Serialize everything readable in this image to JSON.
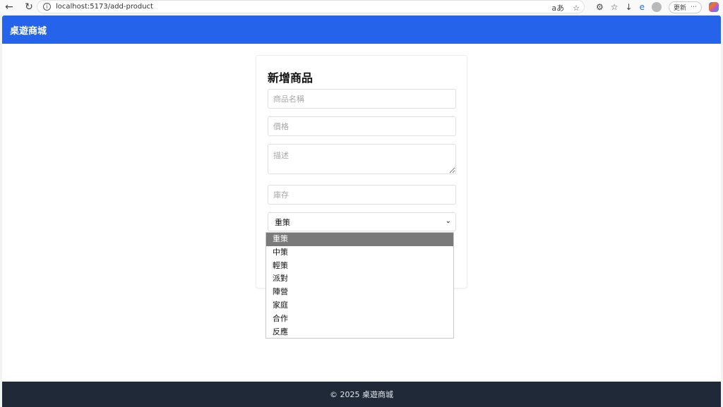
{
  "browser": {
    "url": "localhost:5173/add-product",
    "update_label": "更新",
    "more": "⋯"
  },
  "header": {
    "brand": "桌遊商城"
  },
  "form": {
    "title": "新增商品",
    "name_placeholder": "商品名稱",
    "price_placeholder": "價格",
    "description_placeholder": "描述",
    "stock_placeholder": "庫存",
    "category_selected": "重策"
  },
  "dropdown": {
    "options": [
      "重策",
      "中策",
      "輕策",
      "派對",
      "陣營",
      "家庭",
      "合作",
      "反應"
    ]
  },
  "footer": {
    "text": "© 2025 桌遊商城"
  }
}
